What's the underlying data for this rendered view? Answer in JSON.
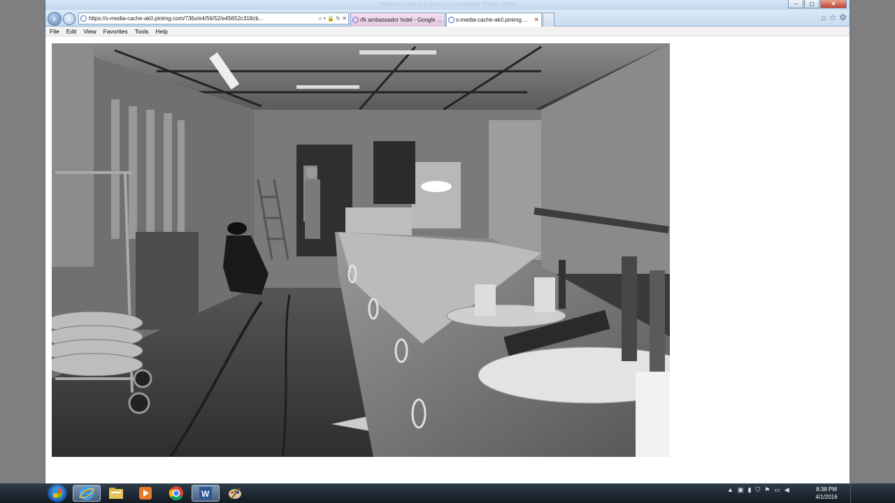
{
  "window": {
    "title": "Windows Internet Explorer (Compatibility Mode) - Word",
    "controls": {
      "minimize": "–",
      "maximize": "▢",
      "close": "✕"
    }
  },
  "nav": {
    "address": "https://s-media-cache-ak0.pinimg.com/736x/e4/56/52/e45652c318cb...",
    "address_tools": "⌕ ▾ 🔒 ↻ ✕",
    "tabs": [
      {
        "label": "rfk ambassador hotel - Google ..."
      },
      {
        "label": "s-media-cache-ak0.pinimg....",
        "close": "✕"
      }
    ]
  },
  "menu": [
    "File",
    "Edit",
    "View",
    "Favorites",
    "Tools",
    "Help"
  ],
  "taskbar": {
    "clock_time": "8:38 PM",
    "clock_date": "4/1/2016"
  }
}
